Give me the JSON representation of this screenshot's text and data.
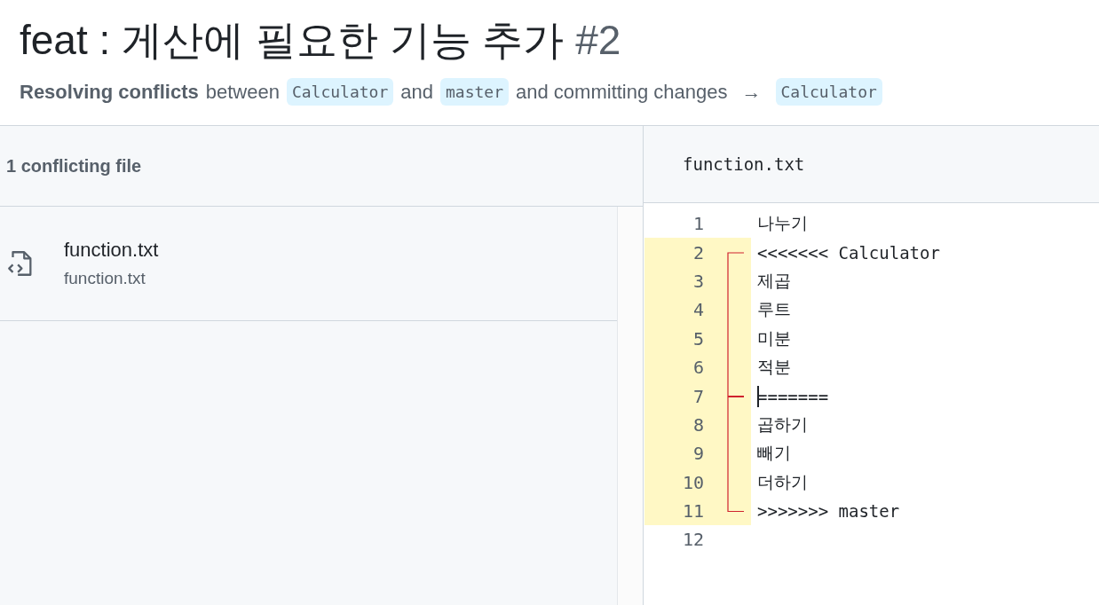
{
  "title": {
    "text": "feat : 게산에 필요한 기능 추가",
    "number": "#2"
  },
  "subtitle": {
    "lead": "Resolving conflicts",
    "between": "between",
    "head_branch": "Calculator",
    "and": "and",
    "base_branch": "master",
    "committing": "and committing changes",
    "arrow": "→",
    "target_branch": "Calculator"
  },
  "sidebar": {
    "heading": "1 conflicting file",
    "files": [
      {
        "name": "function.txt",
        "path": "function.txt"
      }
    ]
  },
  "editor": {
    "filename": "function.txt",
    "lines": [
      {
        "number": "1",
        "text": "나누기",
        "conflict": false,
        "kind": "plain"
      },
      {
        "number": "2",
        "text": "<<<<<<< Calculator",
        "conflict": true,
        "kind": "start"
      },
      {
        "number": "3",
        "text": "제곱",
        "conflict": true,
        "kind": "body"
      },
      {
        "number": "4",
        "text": "루트",
        "conflict": true,
        "kind": "body"
      },
      {
        "number": "5",
        "text": "미분",
        "conflict": true,
        "kind": "body"
      },
      {
        "number": "6",
        "text": "적분",
        "conflict": true,
        "kind": "body"
      },
      {
        "number": "7",
        "text": "=======",
        "conflict": true,
        "kind": "separator",
        "cursor": true
      },
      {
        "number": "8",
        "text": "곱하기",
        "conflict": true,
        "kind": "body"
      },
      {
        "number": "9",
        "text": "빼기",
        "conflict": true,
        "kind": "body"
      },
      {
        "number": "10",
        "text": "더하기",
        "conflict": true,
        "kind": "body"
      },
      {
        "number": "11",
        "text": ">>>>>>> master",
        "conflict": true,
        "kind": "end"
      },
      {
        "number": "12",
        "conflict": false
      }
    ]
  }
}
